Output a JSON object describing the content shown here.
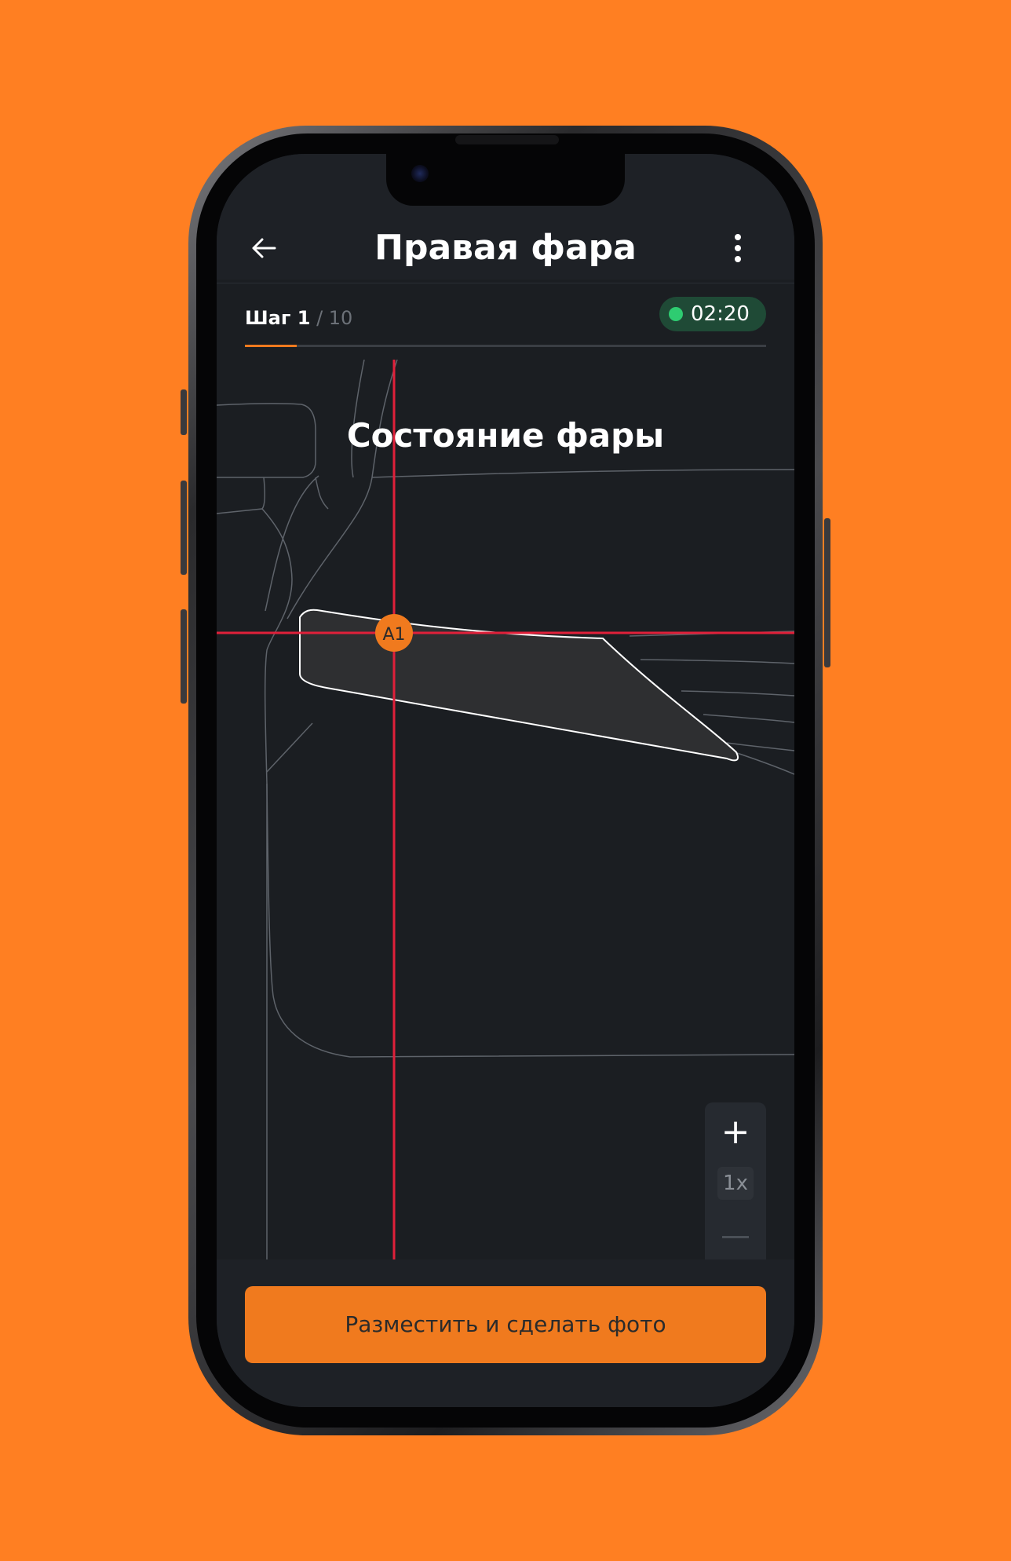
{
  "header": {
    "title": "Правая фара",
    "back_icon": "arrow-left-icon",
    "menu_icon": "more-vertical-icon"
  },
  "progress": {
    "step_label": "Шаг 1",
    "step_total": " / 10",
    "current_step": 1,
    "total_steps": 10
  },
  "timer": {
    "time": "02:20",
    "status_color": "#2ECC71"
  },
  "canvas": {
    "part_title": "Состояние фары",
    "marker_label": "A1",
    "crosshair_color": "#E0203A",
    "marker_color": "#F07A1E"
  },
  "zoom": {
    "in_icon": "plus-icon",
    "in_label": "+",
    "level": "1x",
    "out_icon": "minus-icon"
  },
  "action": {
    "label": "Разместить и сделать фото"
  },
  "colors": {
    "background": "#FF7F22",
    "accent": "#F07A1E",
    "screen": "#1B1E22"
  }
}
